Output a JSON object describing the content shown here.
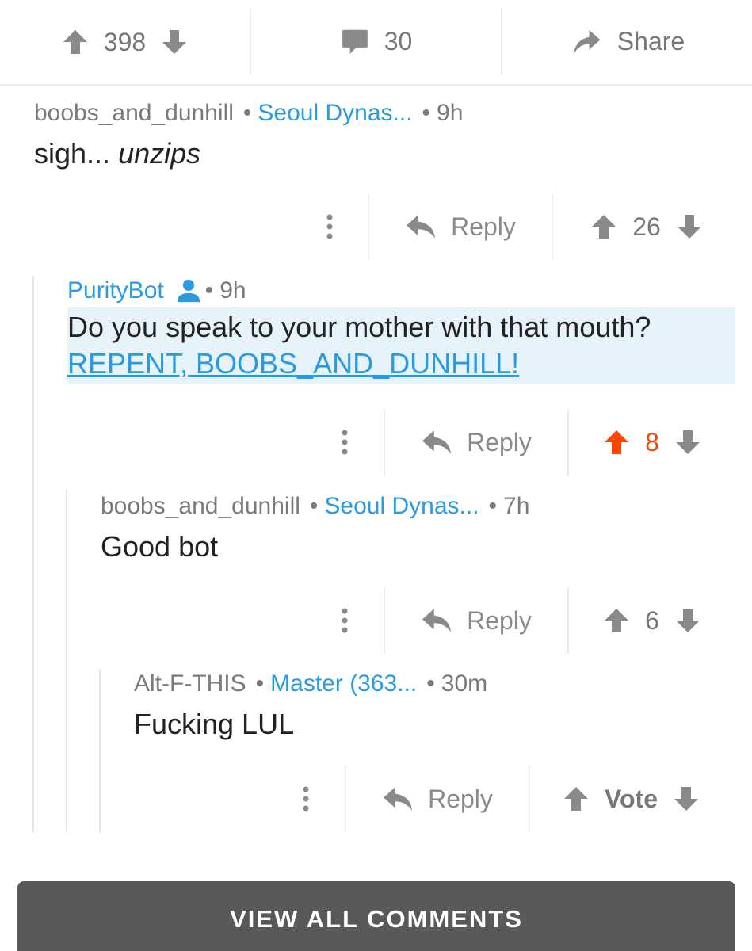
{
  "post_bar": {
    "score": "398",
    "comments": "30",
    "share_label": "Share"
  },
  "comments": [
    {
      "user": "boobs_and_dunhill",
      "flair": "Seoul Dynas...",
      "age": "9h",
      "body_plain": "sigh... ",
      "body_italic": "unzips",
      "reply_label": "Reply",
      "score": "26"
    },
    {
      "user": "PurityBot",
      "age": "9h",
      "body_plain": "Do you speak to your mother with that mouth? ",
      "body_link": "REPENT, BOOBS_AND_DUNHILL!",
      "reply_label": "Reply",
      "score": "8",
      "upvoted": true
    },
    {
      "user": "boobs_and_dunhill",
      "flair": "Seoul Dynas...",
      "age": "7h",
      "body_plain": "Good bot",
      "reply_label": "Reply",
      "score": "6"
    },
    {
      "user": "Alt-F-THIS",
      "flair": "Master (363...",
      "age": "30m",
      "body_plain": "Fucking LUL",
      "reply_label": "Reply",
      "score": "Vote"
    }
  ],
  "view_all_label": "VIEW ALL COMMENTS",
  "colors": {
    "accent_blue": "#2a9be0",
    "upvote_orange": "#ff4500",
    "muted_gray": "#777777",
    "button_dark": "#595959"
  },
  "icons": {
    "upvote": "arrow-up-icon",
    "downvote": "arrow-down-icon",
    "comment": "comment-bubble-icon",
    "share": "share-arrow-icon",
    "reply": "reply-arrow-icon",
    "menu": "vertical-dots-icon",
    "user": "user-icon"
  }
}
